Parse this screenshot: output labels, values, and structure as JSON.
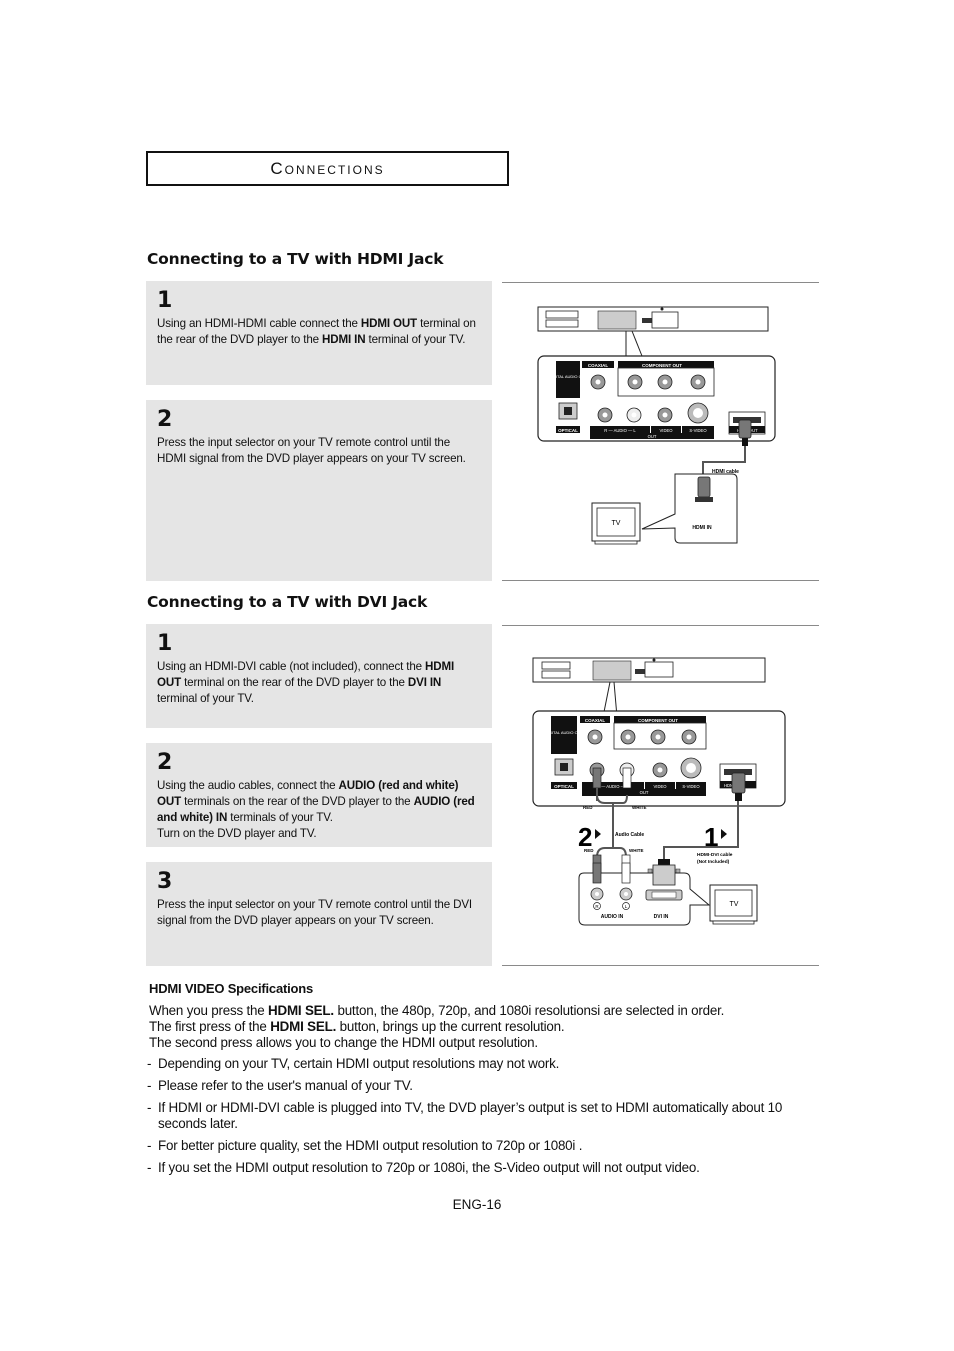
{
  "chapter": {
    "title": "Connections"
  },
  "hdmi_section": {
    "heading": "Connecting to a TV with HDMI Jack",
    "steps": [
      {
        "number": "1",
        "parts": [
          {
            "t": "Using an HDMI-HDMI cable connect the "
          },
          {
            "b": "HDMI OUT"
          },
          {
            "t": " terminal on the rear of the DVD player to the "
          },
          {
            "b": "HDMI IN"
          },
          {
            "t": " terminal of your TV."
          }
        ]
      },
      {
        "number": "2",
        "parts": [
          {
            "t": "Press the input selector on your TV remote control until the HDMI signal from the DVD player appears on your TV screen."
          }
        ]
      }
    ],
    "diagram": {
      "labels": {
        "coaxial": "COAXIAL",
        "component_out": "COMPONENT OUT",
        "digital_audio_out": "DIGITAL AUDIO OUT",
        "optical": "OPTICAL",
        "audio": "R — AUDIO — L",
        "video": "VIDEO",
        "s_video": "S-VIDEO",
        "out": "OUT",
        "hdmi_out": "HDMI OUT",
        "hdmi_cable": "HDMI cable",
        "hdmi_in": "HDMI IN",
        "tv": "TV"
      }
    }
  },
  "dvi_section": {
    "heading": "Connecting to a TV with DVI Jack",
    "steps": [
      {
        "number": "1",
        "parts": [
          {
            "t": "Using an HDMI-DVI cable (not included), connect the "
          },
          {
            "b": "HDMI OUT"
          },
          {
            "t": " terminal on the rear of the DVD player to the "
          },
          {
            "b": "DVI IN"
          },
          {
            "t": " terminal of your TV."
          }
        ]
      },
      {
        "number": "2",
        "parts": [
          {
            "t": "Using the audio cables, connect the "
          },
          {
            "b": "AUDIO (red and white) OUT"
          },
          {
            "t": " terminals on the rear of the DVD player to the "
          },
          {
            "b": "AUDIO (red and white) IN"
          },
          {
            "t": " terminals of your TV."
          },
          {
            "br": true
          },
          {
            "t": "Turn on the DVD player and TV."
          }
        ]
      },
      {
        "number": "3",
        "parts": [
          {
            "t": "Press the input selector on your TV remote control until the DVI signal from the DVD player appears on your TV screen."
          }
        ]
      }
    ],
    "diagram": {
      "labels": {
        "coaxial": "COAXIAL",
        "component_out": "COMPONENT OUT",
        "digital_audio_out": "DIGITAL AUDIO OUT",
        "optical": "OPTICAL",
        "audio": "— AUDIO —",
        "video": "VIDEO",
        "s_video": "S-VIDEO",
        "out": "OUT",
        "hdmi_out": "HDMI OUT",
        "red": "RED",
        "white": "WHITE",
        "audio_cable": "Audio Cable",
        "hdmi_dvi_cable": "HDMI-DVI cable",
        "not_included": "(Not Included)",
        "step2_marker": "2",
        "step1_marker": "1",
        "audio_in": "AUDIO IN",
        "dvi_in": "DVI IN",
        "r": "R",
        "l": "L",
        "tv": "TV"
      }
    }
  },
  "specs": {
    "title": "HDMI VIDEO Specifications",
    "intro": [
      [
        {
          "t": "When you press the "
        },
        {
          "b": "HDMI SEL."
        },
        {
          "t": " button, the 480p, 720p, and 1080i resolutionsi are selected in order."
        }
      ],
      [
        {
          "t": "The first press of the "
        },
        {
          "b": "HDMI SEL."
        },
        {
          "t": " button, brings up the current resolution."
        }
      ],
      [
        {
          "t": "The second press allows you to change the HDMI output resolution."
        }
      ]
    ],
    "bullets": [
      "Depending on your TV, certain HDMI output resolutions may not work.",
      "Please refer to the user's manual of your TV.",
      "If HDMI or HDMI-DVI cable is plugged into TV, the DVD player’s output is set to HDMI automatically about 10 seconds later.",
      "For better picture quality, set the HDMI output resolution to 720p or 1080i .",
      "If you set the HDMI output resolution to 720p or 1080i, the S-Video output will not output video."
    ]
  },
  "footer": {
    "page_number": "ENG-16"
  }
}
